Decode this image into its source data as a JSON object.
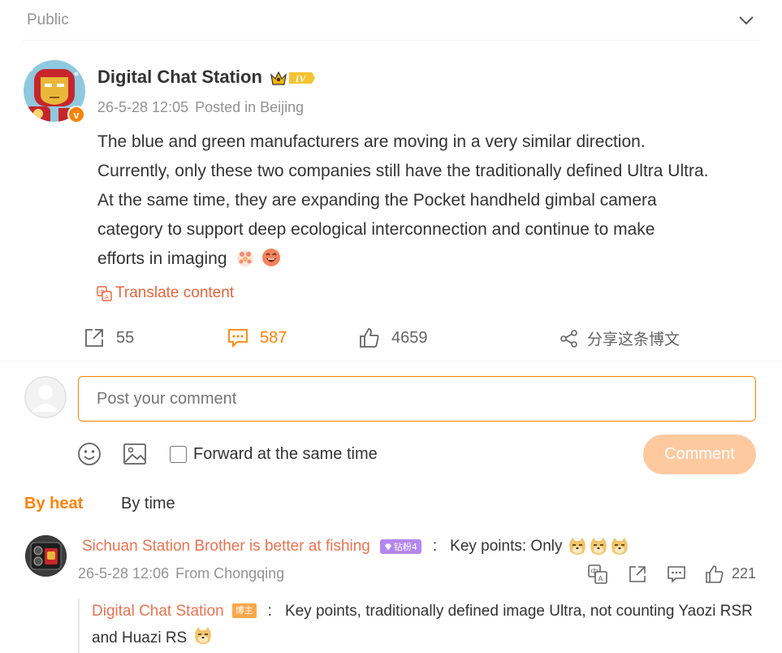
{
  "topbar": {
    "visibility": "Public",
    "expand_icon": "chevron-down-icon"
  },
  "post": {
    "author": "Digital Chat Station",
    "level_badge": "IV",
    "date": "26-5-28 12:05",
    "location": "Posted in Beijing",
    "lines": [
      " The blue and green manufacturers are moving in a very similar direction.",
      "Currently, only these two companies still have the traditionally defined Ultra Ultra.",
      "At the same time, they are expanding the Pocket handheld gimbal camera",
      "category to support deep ecological interconnection and continue to make",
      "efforts in imaging"
    ],
    "translate_label": "Translate content",
    "actions": {
      "forward_count": "55",
      "comment_count": "587",
      "like_count": "4659",
      "share_label": "分享这条博文"
    }
  },
  "composer": {
    "placeholder": "Post your comment",
    "forward_label": "Forward at the same time",
    "submit_label": "Comment"
  },
  "sort": {
    "heat": "By heat",
    "time": "By time"
  },
  "comment": {
    "user": "Sichuan Station Brother is better at fishing",
    "fan_badge": "钻粉4",
    "colon": ":",
    "text": "Key points: Only",
    "date": "26-5-28 12:06",
    "location": "From Chongqing",
    "likes": "221"
  },
  "reply": {
    "user": "Digital Chat Station",
    "badge": "博主",
    "colon": ":",
    "text": "Key points, traditionally defined image Ultra, not counting Yaozi RSR and Huazi RS"
  },
  "colors": {
    "accent": "#ff8200",
    "username": "#eb7350",
    "muted": "#939393"
  }
}
